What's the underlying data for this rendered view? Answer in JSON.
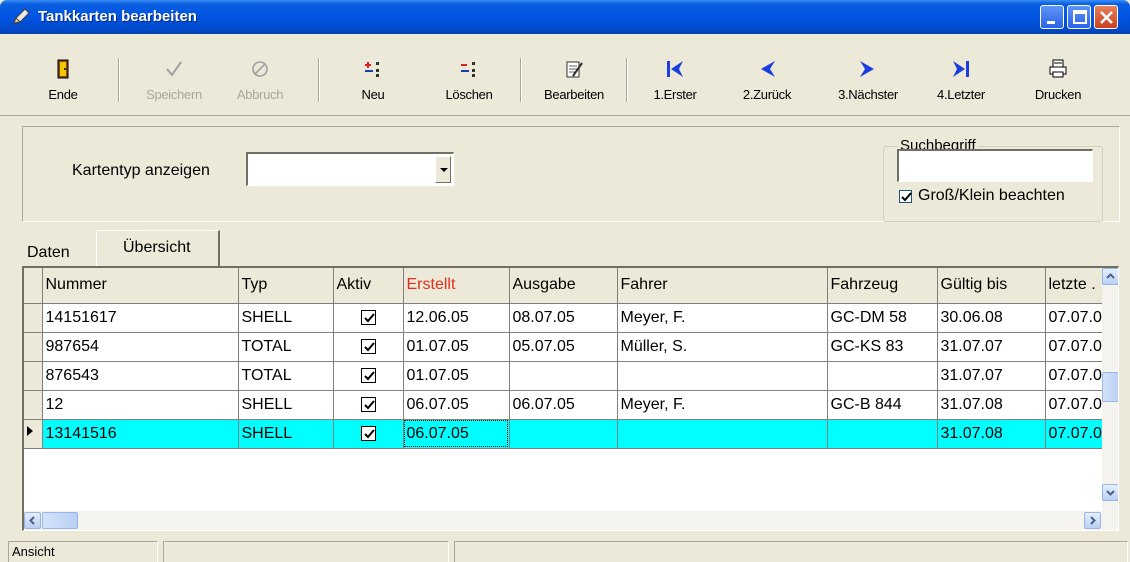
{
  "window": {
    "title": "Tankkarten bearbeiten"
  },
  "toolbar": {
    "buttons": [
      {
        "label": "Ende",
        "icon": "door-exit-icon",
        "enabled": true
      },
      {
        "label": "Speichern",
        "icon": "checkmark-icon",
        "enabled": false
      },
      {
        "label": "Abbruch",
        "icon": "cancel-circle-icon",
        "enabled": false
      },
      {
        "label": "Neu",
        "icon": "new-record-icon",
        "enabled": true
      },
      {
        "label": "Löschen",
        "icon": "delete-record-icon",
        "enabled": true
      },
      {
        "label": "Bearbeiten",
        "icon": "edit-document-icon",
        "enabled": true
      },
      {
        "label": "1.Erster",
        "icon": "first-record-icon",
        "enabled": true
      },
      {
        "label": "2.Zurück",
        "icon": "previous-record-icon",
        "enabled": true
      },
      {
        "label": "3.Nächster",
        "icon": "next-record-icon",
        "enabled": true
      },
      {
        "label": "4.Letzter",
        "icon": "last-record-icon",
        "enabled": true
      },
      {
        "label": "Drucken",
        "icon": "printer-icon",
        "enabled": true
      }
    ]
  },
  "filter": {
    "kartentyp_label": "Kartentyp anzeigen",
    "kartentyp_value": "",
    "suchbegriff_legend": "Suchbegriff",
    "suchbegriff_value": "",
    "case_sensitive_label": "Groß/Klein beachten",
    "case_sensitive_checked": true
  },
  "tabs": [
    {
      "label": "Daten",
      "active": false
    },
    {
      "label": "Übersicht",
      "active": true
    }
  ],
  "grid": {
    "columns": [
      "Nummer",
      "Typ",
      "Aktiv",
      "Erstellt",
      "Ausgabe",
      "Fahrer",
      "Fahrzeug",
      "Gültig bis",
      "letzte ."
    ],
    "rows": [
      {
        "nummer": "14151617",
        "typ": "SHELL",
        "aktiv": true,
        "erstellt": "12.06.05",
        "ausgabe": "08.07.05",
        "fahrer": "Meyer, F.",
        "fahrzeug": "GC-DM 58",
        "gueltig": "30.06.08",
        "letzte": "07.07.0"
      },
      {
        "nummer": "987654",
        "typ": "TOTAL",
        "aktiv": true,
        "erstellt": "01.07.05",
        "ausgabe": "05.07.05",
        "fahrer": "Müller, S.",
        "fahrzeug": "GC-KS 83",
        "gueltig": "31.07.07",
        "letzte": "07.07.0"
      },
      {
        "nummer": "876543",
        "typ": "TOTAL",
        "aktiv": true,
        "erstellt": "01.07.05",
        "ausgabe": "",
        "fahrer": "",
        "fahrzeug": "",
        "gueltig": "31.07.07",
        "letzte": "07.07.0"
      },
      {
        "nummer": "12",
        "typ": "SHELL",
        "aktiv": true,
        "erstellt": "06.07.05",
        "ausgabe": "06.07.05",
        "fahrer": "Meyer, F.",
        "fahrzeug": "GC-B 844",
        "gueltig": "31.07.08",
        "letzte": "07.07.0"
      },
      {
        "nummer": "13141516",
        "typ": "SHELL",
        "aktiv": true,
        "erstellt": "06.07.05",
        "ausgabe": "",
        "fahrer": "",
        "fahrzeug": "",
        "gueltig": "31.07.08",
        "letzte": "07.07.0"
      }
    ],
    "selected_row": 4
  },
  "statusbar": {
    "text": "Ansicht"
  }
}
